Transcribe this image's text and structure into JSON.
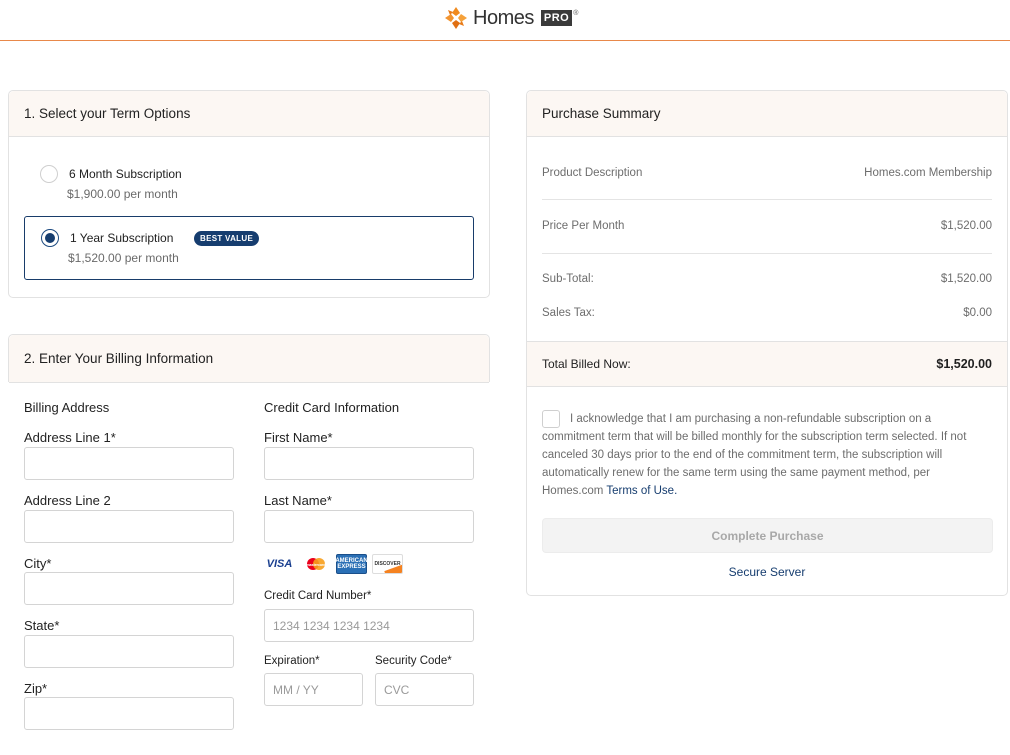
{
  "header": {
    "brand": "Homes",
    "brand_badge": "PRO",
    "trademark": "®"
  },
  "term": {
    "title": "1. Select your Term Options",
    "options": [
      {
        "label": "6 Month Subscription",
        "price": "$1,900.00 per month",
        "selected": false
      },
      {
        "label": "1 Year Subscription",
        "price": "$1,520.00 per month",
        "selected": true,
        "badge": "BEST VALUE"
      }
    ]
  },
  "billing": {
    "title": "2. Enter Your Billing Information",
    "address": {
      "title": "Billing Address",
      "line1_label": "Address Line 1*",
      "line2_label": "Address Line 2",
      "city_label": "City*",
      "state_label": "State*",
      "zip_label": "Zip*"
    },
    "card": {
      "title": "Credit Card Information",
      "first_label": "First Name*",
      "last_label": "Last Name*",
      "number_label": "Credit Card Number*",
      "number_placeholder": "1234 1234 1234 1234",
      "exp_label": "Expiration*",
      "exp_placeholder": "MM / YY",
      "cvc_label": "Security Code*",
      "cvc_placeholder": "CVC",
      "brands": [
        "VISA",
        "mastercard",
        "AMERICAN EXPRESS",
        "DISCOVER"
      ]
    }
  },
  "summary": {
    "title": "Purchase Summary",
    "rows": [
      {
        "label": "Product Description",
        "value": "Homes.com Membership"
      },
      {
        "label": "Price Per Month",
        "value": "$1,520.00"
      },
      {
        "label": "Sub-Total:",
        "value": "$1,520.00"
      },
      {
        "label": "Sales Tax:",
        "value": "$0.00"
      }
    ],
    "total_label": "Total Billed Now:",
    "total_value": "$1,520.00",
    "ack_text": "I acknowledge that I am purchasing a non-refundable subscription on a commitment term that will be billed monthly for the subscription term selected. If not canceled 30 days prior to the end of the commitment term, the subscription will automatically renew for the same term using the same payment method, per Homes.com ",
    "ack_link": "Terms of Use.",
    "button": "Complete Purchase",
    "secure": "Secure Server"
  },
  "colors": {
    "accent": "#e8884a",
    "primary": "#163d6f",
    "panel_head": "#fcf7f3"
  }
}
